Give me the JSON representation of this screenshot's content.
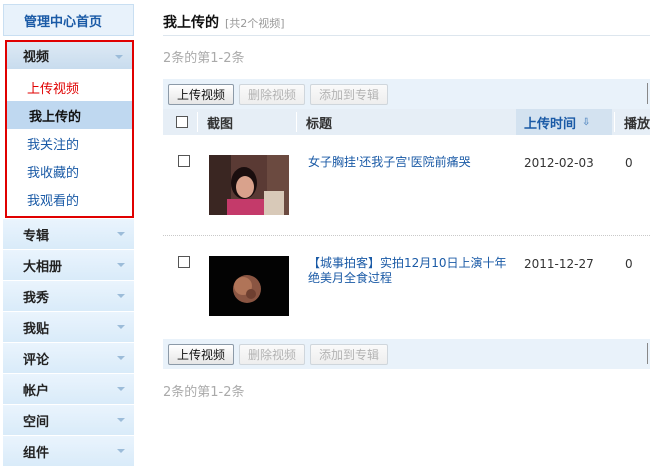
{
  "sidebar": {
    "home_label": "管理中心首页",
    "video_section": {
      "label": "视频",
      "items": [
        "上传视频",
        "我上传的",
        "我关注的",
        "我收藏的",
        "我观看的"
      ]
    },
    "sections": [
      "专辑",
      "大相册",
      "我秀",
      "我贴",
      "评论",
      "帐户",
      "空间",
      "组件"
    ]
  },
  "main": {
    "title": "我上传的",
    "count_text": "[共2个视频]",
    "pager_text": "2条的第1-2条",
    "toolbar": {
      "upload": "上传视频",
      "delete": "删除视频",
      "add_album": "添加到专辑"
    },
    "columns": {
      "thumb": "截图",
      "title": "标题",
      "upload_time": "上传时间",
      "plays": "播放"
    },
    "rows": [
      {
        "title": "女子胸挂'还我子宫'医院前痛哭",
        "date": "2012-02-03",
        "plays": "0"
      },
      {
        "title": "【城事拍客】实拍12月10日上演十年绝美月全食过程",
        "date": "2011-12-27",
        "plays": "0"
      }
    ]
  },
  "colors": {
    "accent_link": "#1a5aa6",
    "highlight_red": "#e00000",
    "header_bg": "#e6eef6"
  }
}
